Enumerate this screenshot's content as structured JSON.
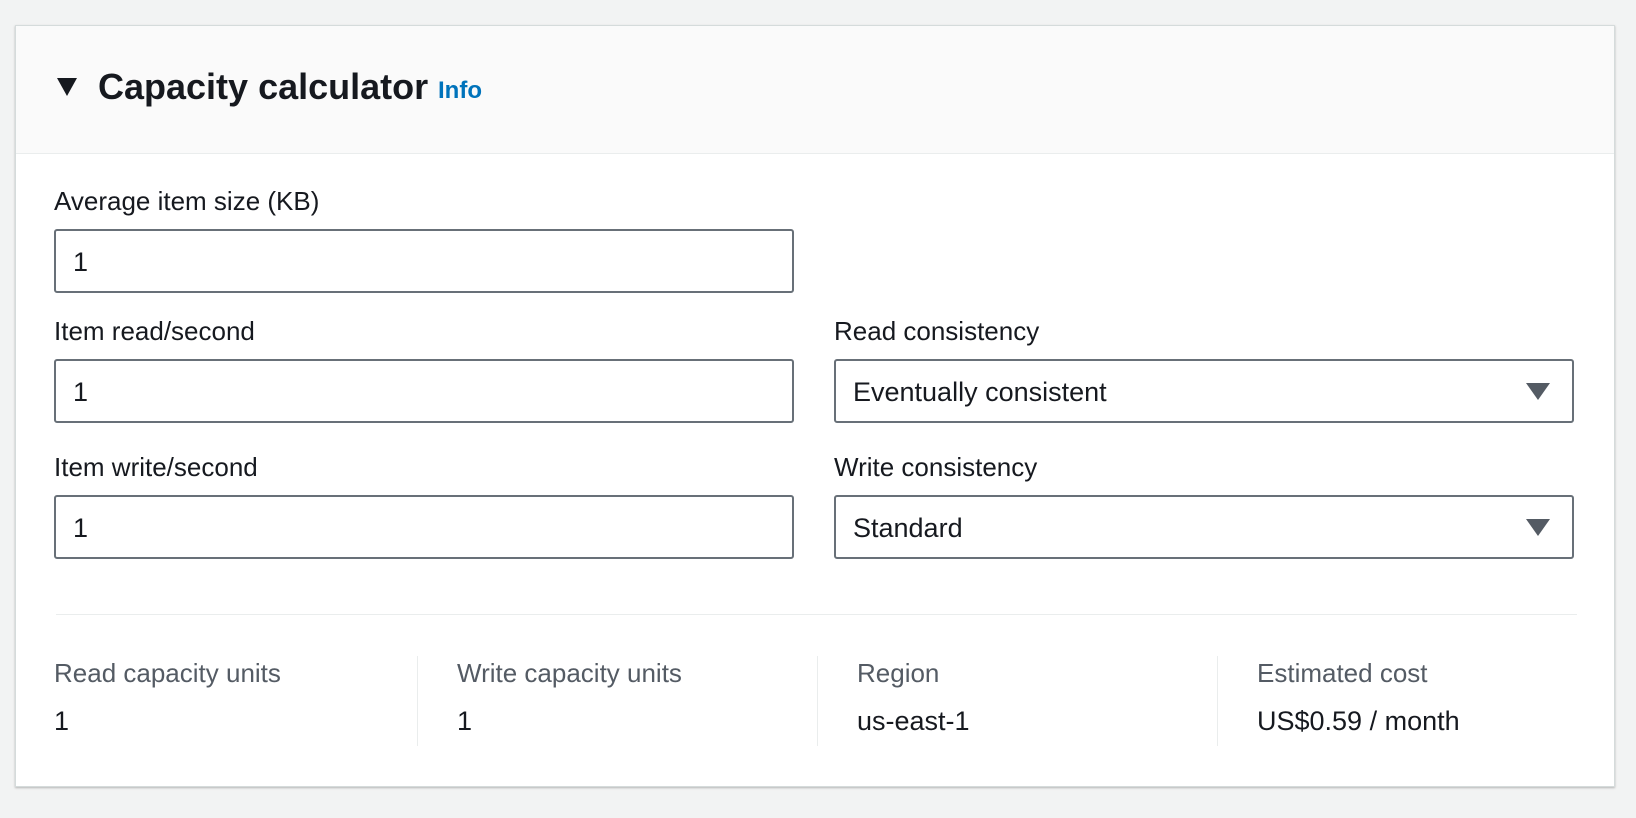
{
  "panel": {
    "title": "Capacity calculator",
    "info_link": "Info",
    "toggle_icon": "caret-down-icon"
  },
  "fields": {
    "avg_item_size": {
      "label": "Average item size (KB)",
      "value": "1"
    },
    "item_read": {
      "label": "Item read/second",
      "value": "1"
    },
    "item_write": {
      "label": "Item write/second",
      "value": "1"
    },
    "read_consistency": {
      "label": "Read consistency",
      "selected": "Eventually consistent",
      "icon": "caret-down-icon"
    },
    "write_consistency": {
      "label": "Write consistency",
      "selected": "Standard",
      "icon": "caret-down-icon"
    }
  },
  "summary": [
    {
      "label": "Read capacity units",
      "value": "1"
    },
    {
      "label": "Write capacity units",
      "value": "1"
    },
    {
      "label": "Region",
      "value": "us-east-1"
    },
    {
      "label": "Estimated cost",
      "value": "US$0.59 / month"
    }
  ],
  "colors": {
    "page_background": "#f2f3f3",
    "header_background": "#fafafa",
    "link": "#0073bb",
    "input_border": "#687078",
    "secondary_text": "#545b64",
    "primary_text": "#16191f"
  }
}
